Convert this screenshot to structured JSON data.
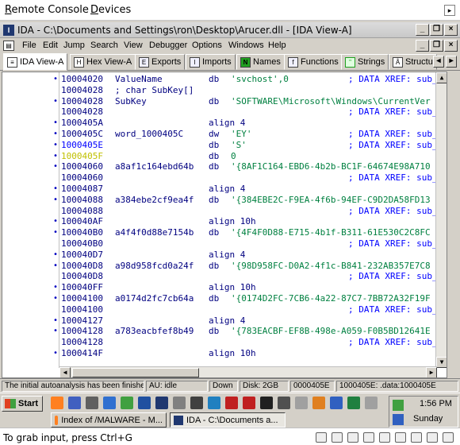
{
  "rc_menu": {
    "remote": "Remote Console",
    "devices": "Devices",
    "remote_u": "R",
    "remote_rest": "emote Console",
    "devices_u": "D",
    "devices_rest": "evices"
  },
  "window": {
    "title": "IDA - C:\\Documents and Settings\\ron\\Desktop\\Arucer.dll - [IDA View-A]"
  },
  "menu": [
    "File",
    "Edit",
    "Jump",
    "Search",
    "View",
    "Debugger",
    "Options",
    "Windows",
    "Help"
  ],
  "tabs": [
    {
      "label": "IDA View-A",
      "icon": "ida-view-icon"
    },
    {
      "label": "Hex View-A",
      "icon": "hex-view-icon"
    },
    {
      "label": "Exports",
      "icon": "exports-icon"
    },
    {
      "label": "Imports",
      "icon": "imports-icon"
    },
    {
      "label": "Names",
      "icon": "names-icon"
    },
    {
      "label": "Functions",
      "icon": "functions-icon"
    },
    {
      "label": "Strings",
      "icon": "strings-icon"
    },
    {
      "label": "Structu",
      "icon": "structures-icon"
    }
  ],
  "lines": [
    {
      "dot": "•",
      "addr": "10004020",
      "label": "ValueName",
      "op": "db",
      "arg": "'svchost',0",
      "cmt": "; DATA XREF: sub_"
    },
    {
      "dot": "",
      "addr": "10004028",
      "label": "; char SubKey[]",
      "op": "",
      "arg": "",
      "cmt": ""
    },
    {
      "dot": "•",
      "addr": "10004028",
      "label": "SubKey",
      "op": "db",
      "arg": "'SOFTWARE\\Microsoft\\Windows\\CurrentVer",
      "cmt": ""
    },
    {
      "dot": "",
      "addr": "10004028",
      "label": "",
      "op": "",
      "arg": "",
      "cmt": "; DATA XREF: sub_"
    },
    {
      "dot": "•",
      "addr": "1000405A",
      "label": "",
      "op": "align 4",
      "arg": "",
      "cmt": ""
    },
    {
      "dot": "•",
      "addr": "1000405C",
      "label": "word_1000405C",
      "op": "dw",
      "arg": "'EY'",
      "cmt": "; DATA XREF: sub_"
    },
    {
      "dot": "•",
      "addr": "1000405E",
      "label": "",
      "op": "db",
      "arg": "'S'",
      "cmt": "; DATA XREF: sub_",
      "cur": true
    },
    {
      "dot": "•",
      "addr": "1000405F",
      "label": "",
      "op": "db",
      "arg": "0",
      "cmt": "",
      "hi": true
    },
    {
      "dot": "•",
      "addr": "10004060",
      "label": "a8af1c164ebd64b",
      "op": "db",
      "arg": "'{8AF1C164-EBD6-4b2b-BC1F-64674E98A710",
      "cmt": ""
    },
    {
      "dot": "",
      "addr": "10004060",
      "label": "",
      "op": "",
      "arg": "",
      "cmt": "; DATA XREF: sub_"
    },
    {
      "dot": "•",
      "addr": "10004087",
      "label": "",
      "op": "align 4",
      "arg": "",
      "cmt": ""
    },
    {
      "dot": "•",
      "addr": "10004088",
      "label": "a384ebe2cf9ea4f",
      "op": "db",
      "arg": "'{384EBE2C-F9EA-4f6b-94EF-C9D2DA58FD13",
      "cmt": ""
    },
    {
      "dot": "",
      "addr": "10004088",
      "label": "",
      "op": "",
      "arg": "",
      "cmt": "; DATA XREF: sub_"
    },
    {
      "dot": "•",
      "addr": "100040AF",
      "label": "",
      "op": "align 10h",
      "arg": "",
      "cmt": ""
    },
    {
      "dot": "•",
      "addr": "100040B0",
      "label": "a4f4f0d88e7154b",
      "op": "db",
      "arg": "'{4F4F0D88-E715-4b1f-B311-61E530C2C8FC",
      "cmt": ""
    },
    {
      "dot": "",
      "addr": "100040B0",
      "label": "",
      "op": "",
      "arg": "",
      "cmt": "; DATA XREF: sub_"
    },
    {
      "dot": "•",
      "addr": "100040D7",
      "label": "",
      "op": "align 4",
      "arg": "",
      "cmt": ""
    },
    {
      "dot": "•",
      "addr": "100040D8",
      "label": "a98d958fcd0a24f",
      "op": "db",
      "arg": "'{98D958FC-D0A2-4f1c-B841-232AB357E7C8",
      "cmt": ""
    },
    {
      "dot": "",
      "addr": "100040D8",
      "label": "",
      "op": "",
      "arg": "",
      "cmt": "; DATA XREF: sub_"
    },
    {
      "dot": "•",
      "addr": "100040FF",
      "label": "",
      "op": "align 10h",
      "arg": "",
      "cmt": ""
    },
    {
      "dot": "•",
      "addr": "10004100",
      "label": "a0174d2fc7cb64a",
      "op": "db",
      "arg": "'{0174D2FC-7CB6-4a22-87C7-7BB72A32F19F",
      "cmt": ""
    },
    {
      "dot": "",
      "addr": "10004100",
      "label": "",
      "op": "",
      "arg": "",
      "cmt": "; DATA XREF: sub_"
    },
    {
      "dot": "•",
      "addr": "10004127",
      "label": "",
      "op": "align 4",
      "arg": "",
      "cmt": ""
    },
    {
      "dot": "•",
      "addr": "10004128",
      "label": "a783eacbfef8b49",
      "op": "db",
      "arg": "'{783EACBF-EF8B-498e-A059-F0B5BD12641E",
      "cmt": ""
    },
    {
      "dot": "",
      "addr": "10004128",
      "label": "",
      "op": "",
      "arg": "",
      "cmt": "; DATA XREF: sub_"
    },
    {
      "dot": "•",
      "addr": "1000414F",
      "label": "",
      "op": "align 10h",
      "arg": "",
      "cmt": ""
    }
  ],
  "status": {
    "message": "The initial autoanalysis has been finished.",
    "au": "AU:  idle",
    "direction": "Down",
    "disk": "Disk: 2GB",
    "offset": "0000405E",
    "location": "1000405E: .data:1000405E"
  },
  "taskbar": {
    "start": "Start",
    "tasks": [
      "Index of /MALWARE - M...",
      "IDA - C:\\Documents a..."
    ],
    "time": "1:56 PM",
    "day": "Sunday"
  },
  "hint": "To grab input, press Ctrl+G",
  "colors": {
    "accent": "#000080",
    "string": "#008040",
    "comment": "#0000ff",
    "highlight": "#c0c000"
  }
}
